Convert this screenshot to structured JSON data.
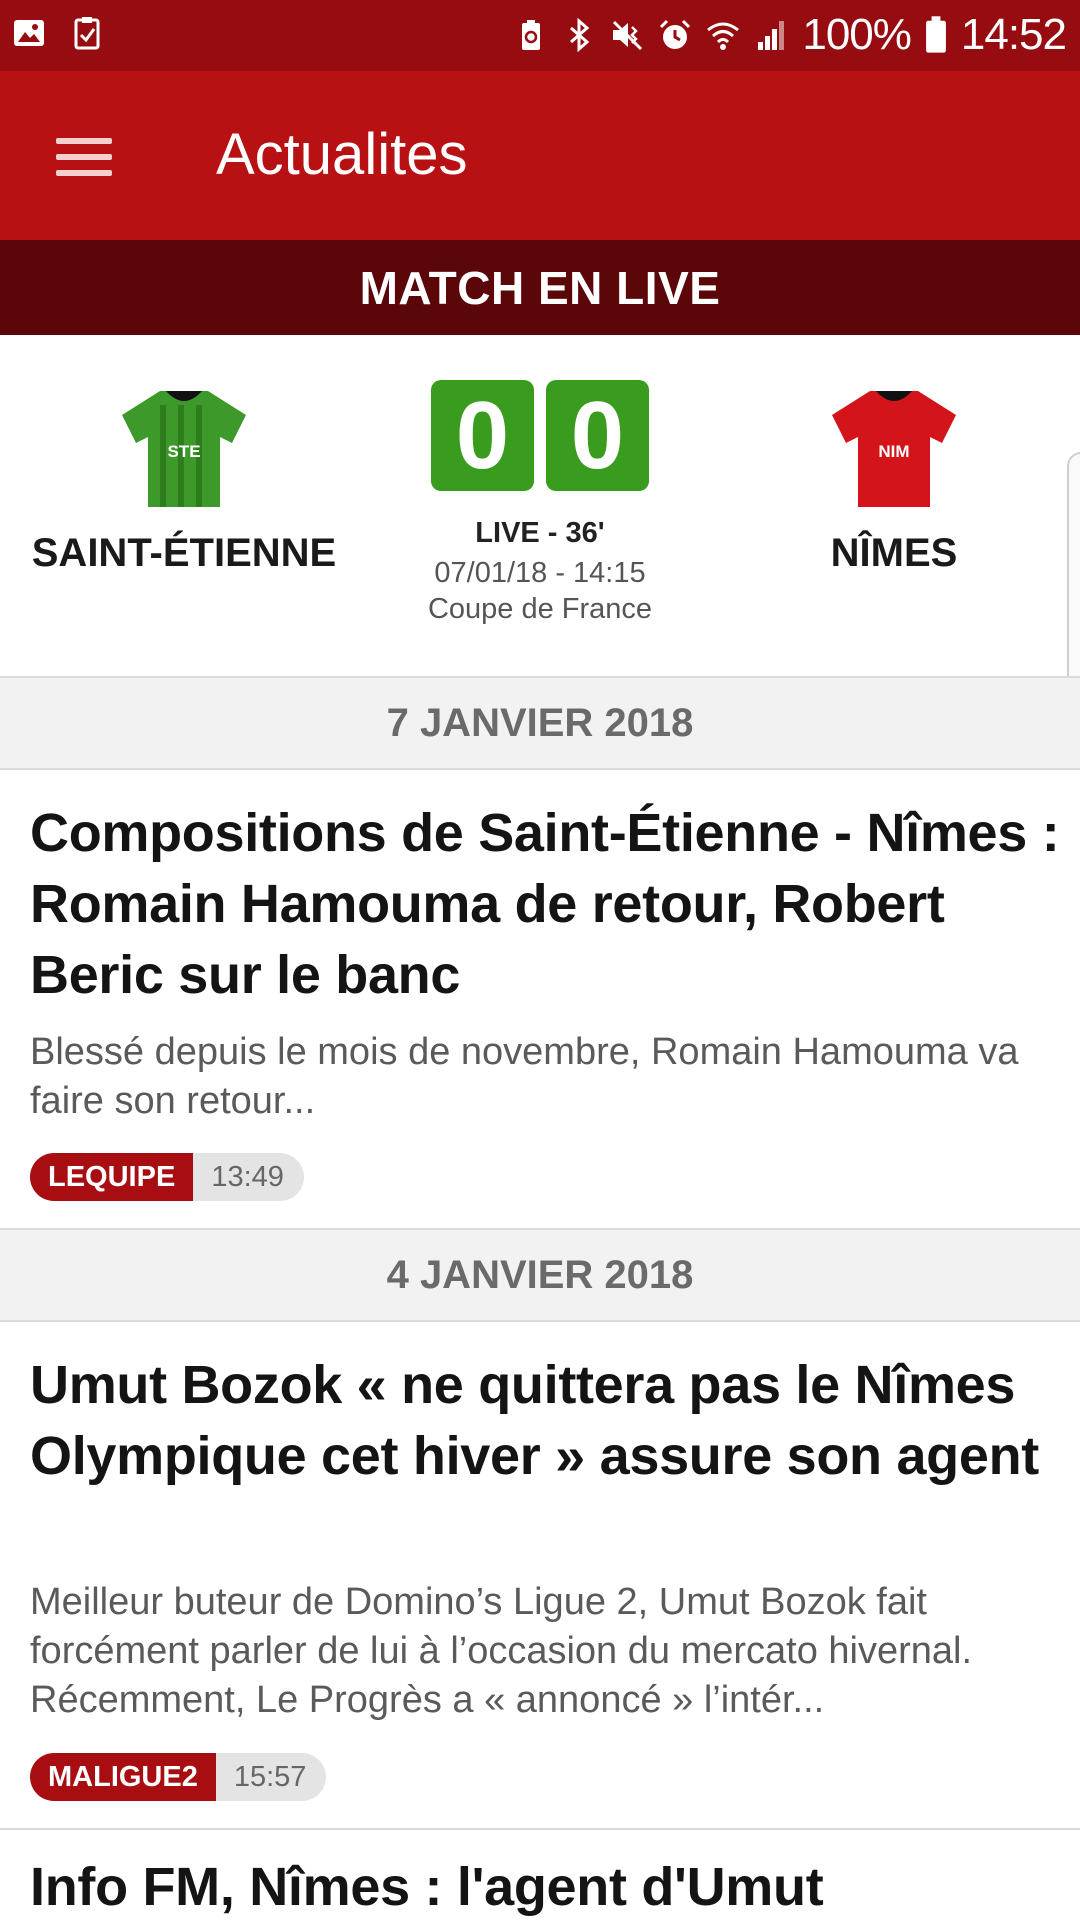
{
  "status_bar": {
    "battery": "100%",
    "time": "14:52",
    "icons": [
      "gallery-icon",
      "clipboard-check-icon",
      "battery-saver-icon",
      "bluetooth-icon",
      "mute-vibrate-icon",
      "alarm-icon",
      "wifi-icon",
      "signal-icon",
      "battery-icon"
    ]
  },
  "app_bar": {
    "title": "Actualites",
    "menu_icon": "hamburger-menu-icon"
  },
  "live_banner": {
    "label": "MATCH EN LIVE"
  },
  "match": {
    "home_team": {
      "name": "SAINT-ÉTIENNE",
      "jersey_label": "STE",
      "jersey_color": "#3d9a2a"
    },
    "away_team": {
      "name": "NÎMES",
      "jersey_label": "NIM",
      "jersey_color": "#d3141b"
    },
    "home_score": "0",
    "away_score": "0",
    "status": "LIVE - 36'",
    "date": "07/01/18 - 14:15",
    "competition": "Coupe de France"
  },
  "feed": {
    "sections": [
      {
        "date_label": "7 JANVIER 2018",
        "articles": [
          {
            "title": "Compositions de Saint-Étienne - Nîmes : Romain Hamouma de retour, Robert Beric sur le banc",
            "summary": "Blessé depuis le mois de novembre, Romain Hamouma va faire son retour...",
            "source": "LEQUIPE",
            "time": "13:49"
          }
        ]
      },
      {
        "date_label": "4 JANVIER 2018",
        "articles": [
          {
            "title": "Umut Bozok « ne quittera pas le Nîmes Olympique cet hiver » assure son agent",
            "summary": "Meilleur buteur de Domino’s Ligue 2, Umut Bozok fait forcément parler de lui à l’occasion du mercato hivernal. Récemment, Le Progrès a « annoncé » l’intér...",
            "source": "MALIGUE2",
            "time": "15:57"
          },
          {
            "title": "Info FM, Nîmes : l'agent d'Umut"
          }
        ]
      }
    ]
  },
  "colors": {
    "status_bar": "#960c10",
    "app_bar": "#b71114",
    "live_banner": "#5b0609",
    "score_green": "#3a9c1e",
    "source_tag": "#a80d12"
  }
}
